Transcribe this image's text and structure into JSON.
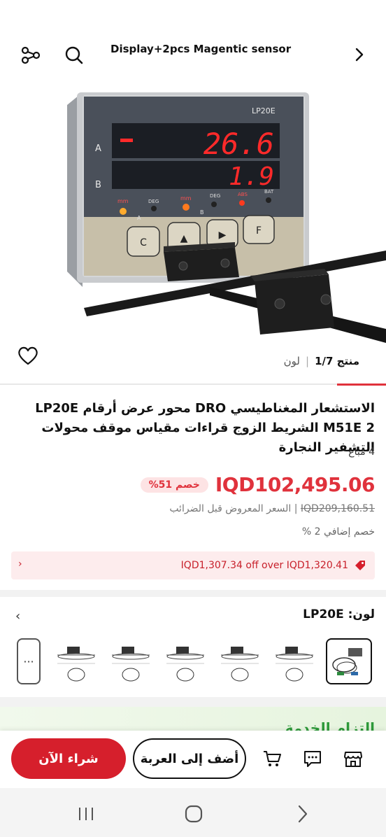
{
  "header": {
    "title": "Display+2pcs Magentic sensor",
    "share_icon": "share-icon",
    "search_icon": "search-icon",
    "next_icon": "chevron-right-icon"
  },
  "product_image": {
    "device_label": "LP20E",
    "row_a": "A",
    "row_b": "B",
    "reading_a": "26.6",
    "reading_b": "1.9",
    "buttons": [
      "C",
      "▲",
      "▶",
      "F"
    ],
    "indicators": [
      "mm",
      "DEG",
      "mm",
      "DEG",
      "ABS",
      "BAT"
    ],
    "group_a": "A",
    "group_b": "B"
  },
  "image_counter": {
    "product": "منتج 1/7",
    "separator": "|",
    "color": "لون"
  },
  "title": "الاستشعار المغناطيسي DRO محور عرض أرقام LP20E M51E 2 الشريط الزوج قراءات مقياس موقف محولات التشفير النجارة",
  "sold": "4 مُباع",
  "price": "IQD102,495.06",
  "discount_badge": "خصم 51%",
  "original_price": "IQD209,160.51",
  "original_sep": "|",
  "original_note": "السعر المعروض قبل الضرائب",
  "extra_discount": "خصم إضافي 2 %",
  "coupon": {
    "text": "IQD1,307.34 off over IQD1,320.41",
    "chevron": "‹",
    "color": "#c8202b"
  },
  "color_selector": {
    "label": "لون: LP20E",
    "chevron": "‹",
    "more": "···",
    "thumbs_count": 6,
    "selected_index": 0
  },
  "service": {
    "text": "التزام الخدمة"
  },
  "actions": {
    "buy_now": "شراء الآن",
    "add_to_cart": "أضف إلى العربة",
    "cart_icon": "cart-icon",
    "chat_icon": "chat-icon",
    "store_icon": "store-icon"
  },
  "colors": {
    "accent": "#e0323c",
    "buy_button": "#d61f2c",
    "display_red": "#ff2a2a"
  }
}
